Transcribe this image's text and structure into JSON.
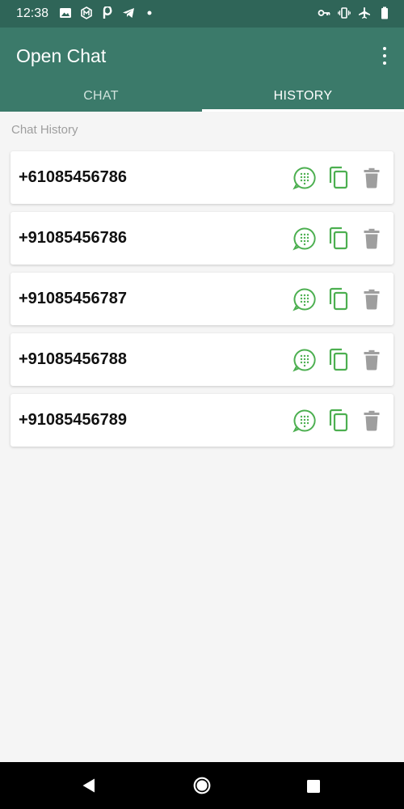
{
  "status_bar": {
    "time": "12:38",
    "left_icons": [
      "image-icon",
      "m-badge-icon",
      "p-app-icon",
      "telegram-icon",
      "dot-icon"
    ],
    "right_icons": [
      "vpn-key-icon",
      "vibrate-icon",
      "airplane-icon",
      "battery-icon"
    ]
  },
  "app_bar": {
    "title": "Open Chat",
    "menu_icon": "more-vert-icon"
  },
  "tabs": [
    {
      "label": "CHAT",
      "selected": false
    },
    {
      "label": "HISTORY",
      "selected": true
    }
  ],
  "history": {
    "section_label": "Chat History",
    "items": [
      {
        "number": "+61085456786"
      },
      {
        "number": "+91085456786"
      },
      {
        "number": "+91085456787"
      },
      {
        "number": "+91085456788"
      },
      {
        "number": "+91085456789"
      }
    ],
    "actions": [
      "whatsapp-icon",
      "copy-icon",
      "delete-icon"
    ]
  },
  "colors": {
    "status_bar": "#2f6558",
    "app_bar": "#3b7a6a",
    "accent_green": "#4caf50",
    "delete_gray": "#9e9e9e",
    "background": "#f5f5f5"
  },
  "nav_bar": {
    "buttons": [
      "back-icon",
      "home-icon",
      "recents-icon"
    ]
  }
}
